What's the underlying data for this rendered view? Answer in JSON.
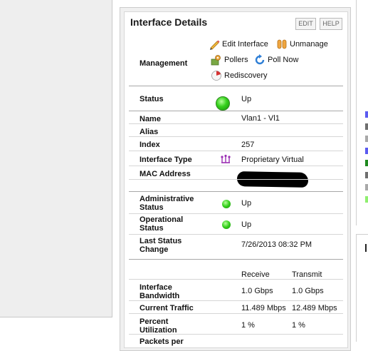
{
  "panel": {
    "title": "Interface Details",
    "buttons": {
      "edit": "EDIT",
      "help": "HELP"
    }
  },
  "management": {
    "label": "Management",
    "actions": [
      {
        "label": "Edit Interface",
        "icon": "pencil-icon"
      },
      {
        "label": "Unmanage",
        "icon": "unmanage-icon"
      },
      {
        "label": "Pollers",
        "icon": "pollers-icon"
      },
      {
        "label": "Poll Now",
        "icon": "refresh-icon"
      },
      {
        "label": "Rediscovery",
        "icon": "rediscovery-icon"
      }
    ]
  },
  "details": {
    "status": {
      "label": "Status",
      "value": "Up"
    },
    "name": {
      "label": "Name",
      "value": "Vlan1 - Vl1"
    },
    "alias": {
      "label": "Alias",
      "value": ""
    },
    "index": {
      "label": "Index",
      "value": "257"
    },
    "interface_type": {
      "label": "Interface Type",
      "value": "Proprietary Virtual"
    },
    "mac_address": {
      "label": "MAC Address",
      "value": ""
    },
    "admin_status": {
      "label_1": "Administrative",
      "label_2": "Status",
      "value": "Up"
    },
    "oper_status": {
      "label_1": "Operational",
      "label_2": "Status",
      "value": "Up"
    },
    "last_change": {
      "label_1": "Last Status",
      "label_2": "Change",
      "value": "7/26/2013 08:32 PM"
    }
  },
  "traffic": {
    "columns": [
      "Receive",
      "Transmit"
    ],
    "rows": [
      {
        "label_1": "Interface",
        "label_2": "Bandwidth",
        "receive": "1.0 Gbps",
        "transmit": "1.0 Gbps"
      },
      {
        "label_1": "Current Traffic",
        "label_2": "",
        "receive": "11.489 Mbps",
        "transmit": "12.489 Mbps"
      },
      {
        "label_1": "Percent",
        "label_2": "Utilization",
        "receive": "1 %",
        "transmit": "1 %"
      },
      {
        "label_1": "Packets per",
        "label_2": "",
        "receive": "",
        "transmit": ""
      }
    ]
  },
  "colors": {
    "status_up": "#33cf1a",
    "legend_marks": [
      "#5b5bf0",
      "#6f6f6f",
      "#a9a9a9",
      "#5b5bf0",
      "#1f8a1f",
      "#6f6f6f",
      "#a9a9a9",
      "#8fef6f"
    ]
  }
}
